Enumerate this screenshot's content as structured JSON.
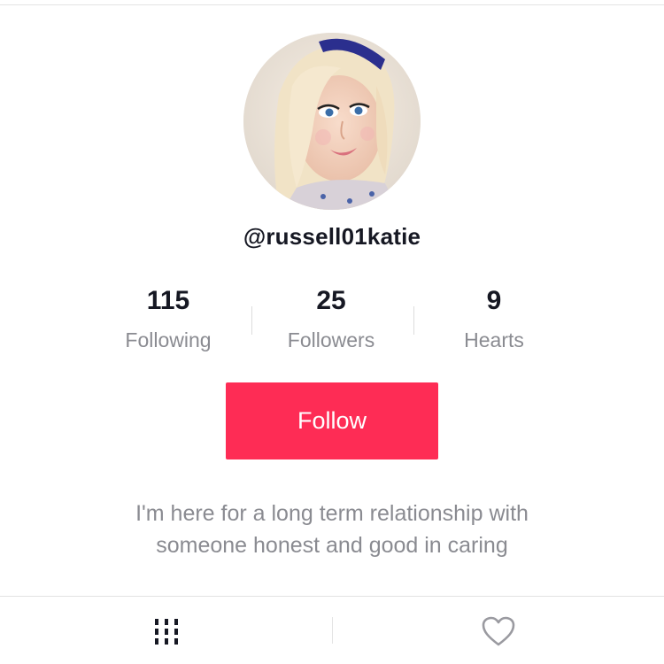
{
  "profile": {
    "username": "@russell01katie",
    "bio_line1": "I'm here for a long term relationship with",
    "bio_line2": "someone honest and good in caring"
  },
  "stats": {
    "following": {
      "value": "115",
      "label": "Following"
    },
    "followers": {
      "value": "25",
      "label": "Followers"
    },
    "hearts": {
      "value": "9",
      "label": "Hearts"
    }
  },
  "actions": {
    "follow_label": "Follow"
  },
  "tabs": [
    {
      "icon": "grid-icon",
      "active": true
    },
    {
      "icon": "heart-icon",
      "active": false
    }
  ],
  "colors": {
    "accent": "#fe2c55",
    "text_primary": "#161823",
    "text_secondary": "#8a8b91"
  }
}
